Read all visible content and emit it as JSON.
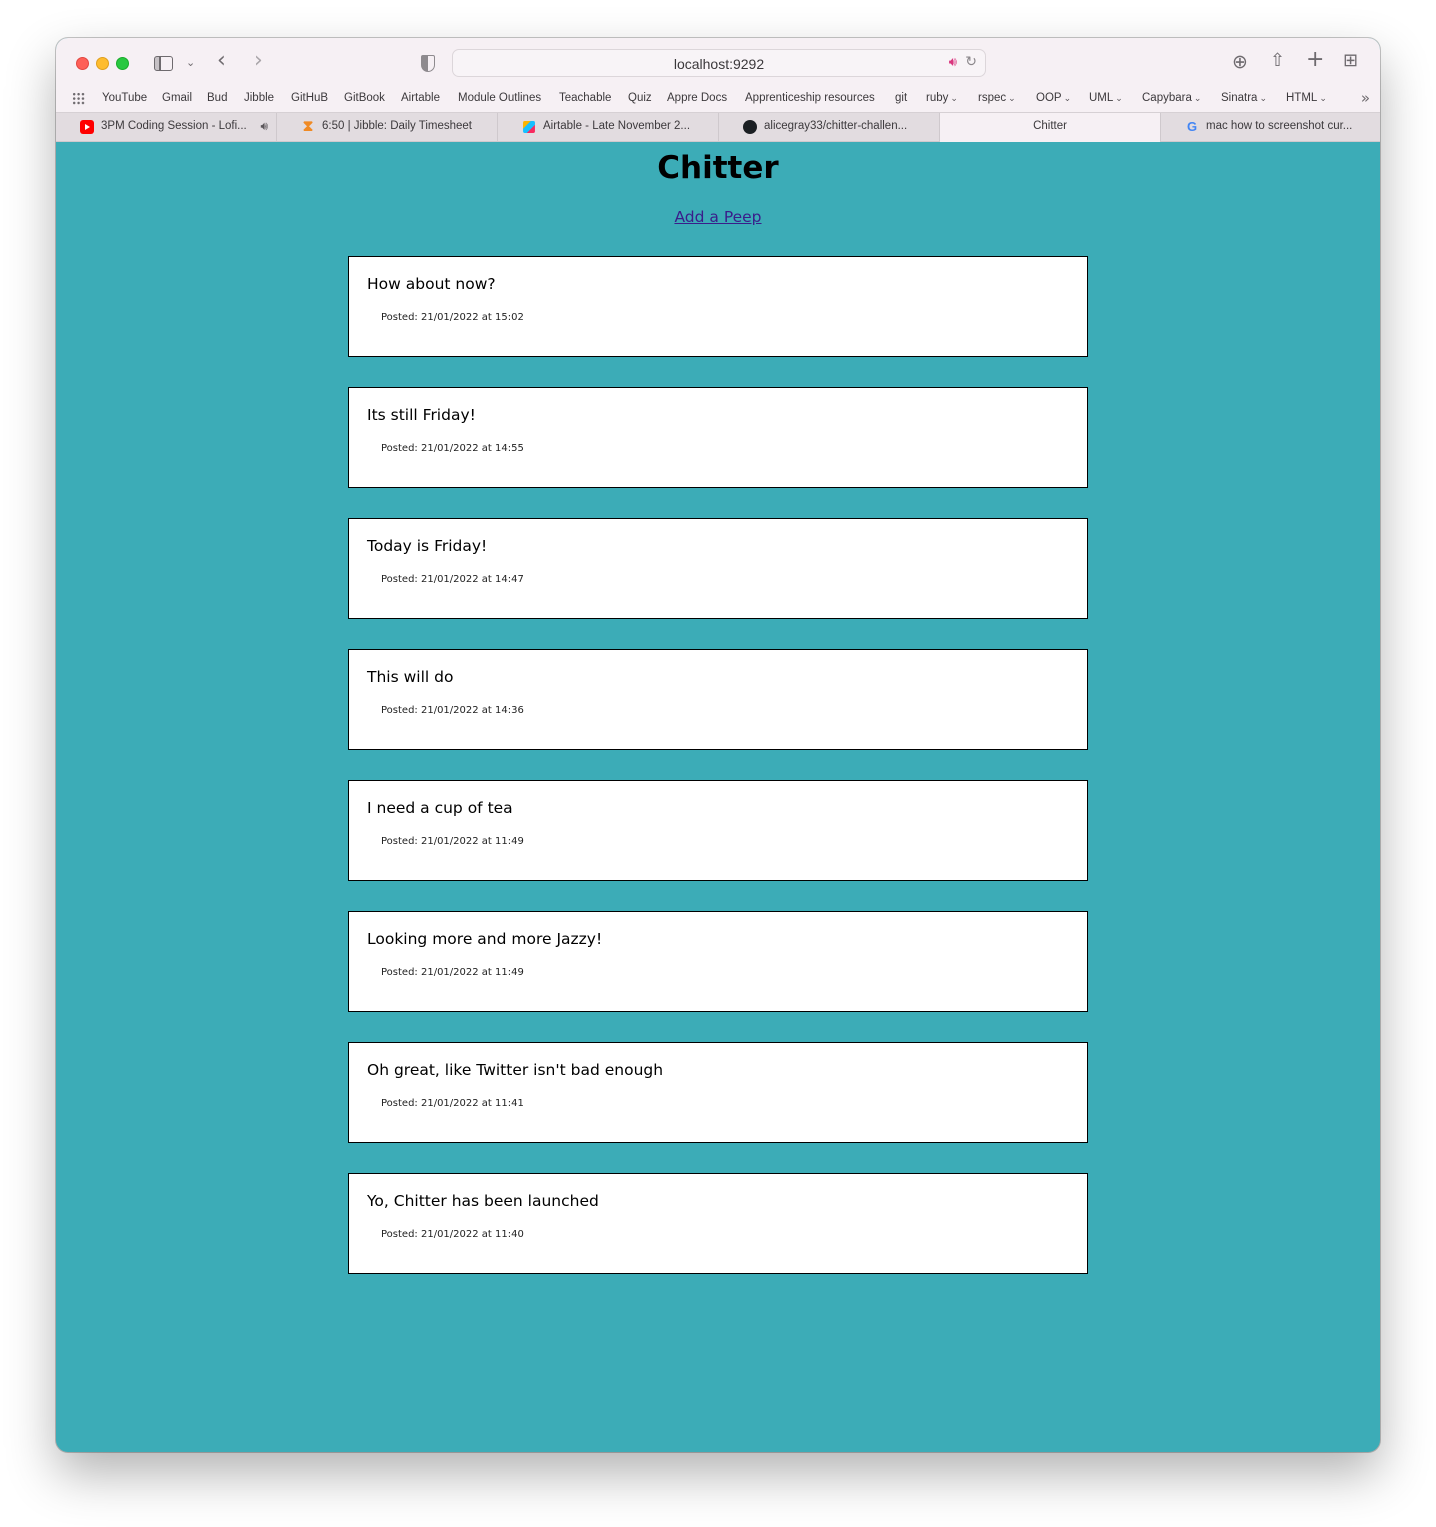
{
  "browser": {
    "url": "localhost:9292",
    "bookmarks": [
      {
        "label": "YouTube",
        "dropdown": false
      },
      {
        "label": "Gmail",
        "dropdown": false
      },
      {
        "label": "Bud",
        "dropdown": false
      },
      {
        "label": "Jibble",
        "dropdown": false
      },
      {
        "label": "GitHuB",
        "dropdown": false
      },
      {
        "label": "GitBook",
        "dropdown": false
      },
      {
        "label": "Airtable",
        "dropdown": false
      },
      {
        "label": "Module Outlines",
        "dropdown": false
      },
      {
        "label": "Teachable",
        "dropdown": false
      },
      {
        "label": "Quiz",
        "dropdown": false
      },
      {
        "label": "Appre Docs",
        "dropdown": false
      },
      {
        "label": "Apprenticeship resources",
        "dropdown": false
      },
      {
        "label": "git",
        "dropdown": false
      },
      {
        "label": "ruby",
        "dropdown": true
      },
      {
        "label": "rspec",
        "dropdown": true
      },
      {
        "label": "OOP",
        "dropdown": true
      },
      {
        "label": "UML",
        "dropdown": true
      },
      {
        "label": "Capybara",
        "dropdown": true
      },
      {
        "label": "Sinatra",
        "dropdown": true
      },
      {
        "label": "HTML",
        "dropdown": true
      }
    ],
    "tabs": [
      {
        "label": "3PM Coding Session - Lofi...",
        "icon": "youtube-icon",
        "active": false,
        "muted": true
      },
      {
        "label": "6:50 | Jibble: Daily Timesheet",
        "icon": "jibble-icon",
        "active": false,
        "muted": false
      },
      {
        "label": "Airtable - Late November 2...",
        "icon": "airtable-icon",
        "active": false,
        "muted": false
      },
      {
        "label": "alicegray33/chitter-challen...",
        "icon": "github-icon",
        "active": false,
        "muted": false
      },
      {
        "label": "Chitter",
        "icon": "",
        "active": true,
        "muted": false
      },
      {
        "label": "mac how to screenshot cur...",
        "icon": "google-icon",
        "active": false,
        "muted": false
      }
    ]
  },
  "page": {
    "title": "Chitter",
    "add_link": "Add a Peep",
    "background": "#3cacb7",
    "peeps": [
      {
        "text": "How about now?",
        "posted": "Posted: 21/01/2022 at 15:02"
      },
      {
        "text": "Its still Friday!",
        "posted": "Posted: 21/01/2022 at 14:55"
      },
      {
        "text": "Today is Friday!",
        "posted": "Posted: 21/01/2022 at 14:47"
      },
      {
        "text": "This will do",
        "posted": "Posted: 21/01/2022 at 14:36"
      },
      {
        "text": "I need a cup of tea",
        "posted": "Posted: 21/01/2022 at 11:49"
      },
      {
        "text": "Looking more and more Jazzy!",
        "posted": "Posted: 21/01/2022 at 11:49"
      },
      {
        "text": "Oh great, like Twitter isn't bad enough",
        "posted": "Posted: 21/01/2022 at 11:41"
      },
      {
        "text": "Yo, Chitter has been launched",
        "posted": "Posted: 21/01/2022 at 11:40"
      }
    ]
  }
}
